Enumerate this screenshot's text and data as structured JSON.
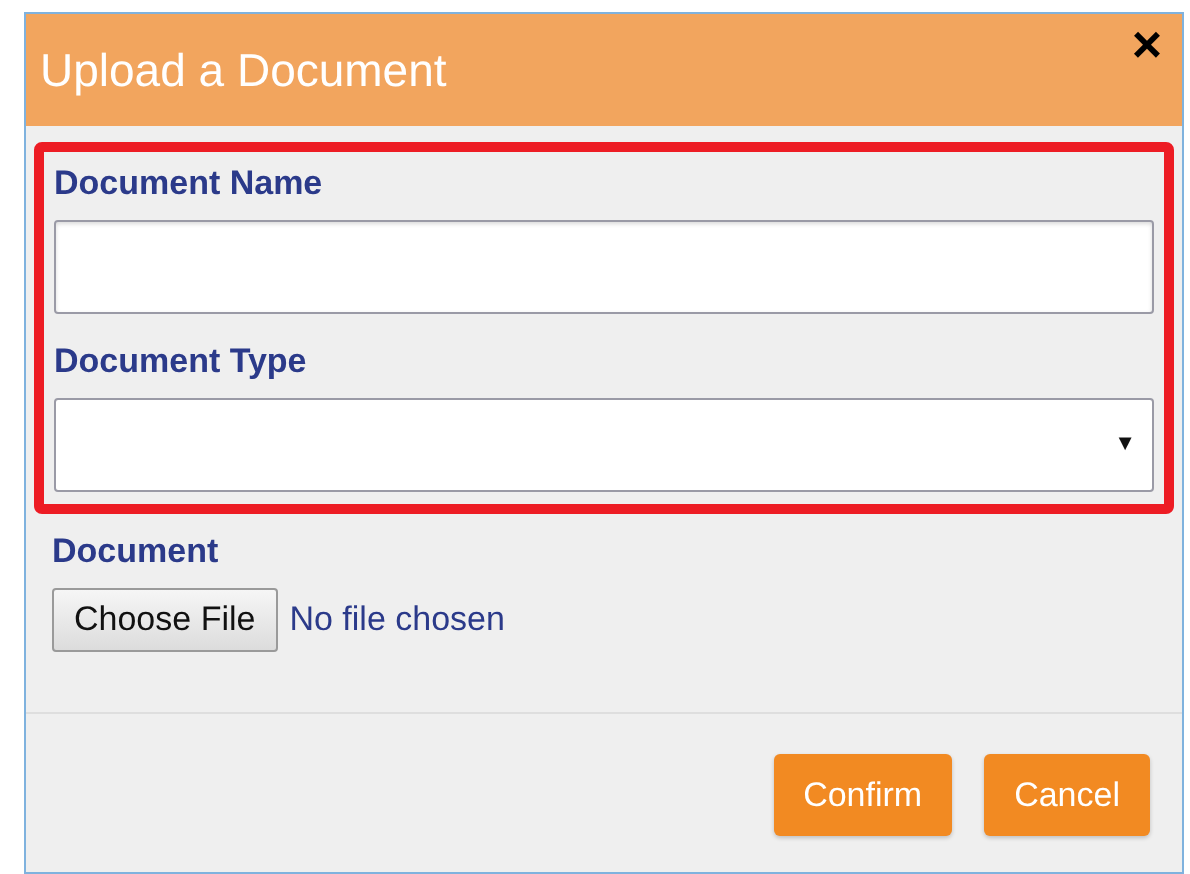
{
  "dialog": {
    "title": "Upload a Document",
    "close": "×"
  },
  "highlighted_fields": [
    {
      "kind": "text",
      "label": "Document Name"
    },
    {
      "kind": "select",
      "label": "Document Type",
      "arrow": "▼"
    }
  ],
  "file_field": {
    "label": "Document",
    "button": "Choose File",
    "status": "No file chosen"
  },
  "buttons": [
    "Confirm",
    "Cancel"
  ]
}
